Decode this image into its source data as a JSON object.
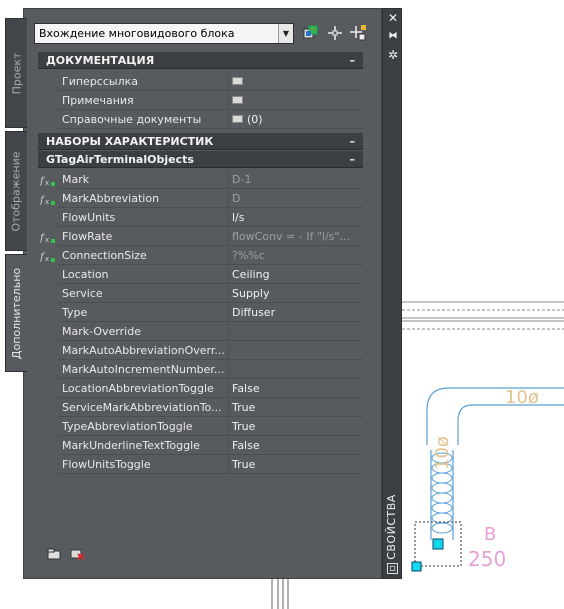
{
  "palette": {
    "selector_value": "Вхождение многовидового блока",
    "title": "СВОЙСТВА",
    "side_tabs": [
      "Проект",
      "Отображение",
      "Дополнительно"
    ]
  },
  "sections": {
    "doc": "ДОКУМЕНТАЦИЯ",
    "sets": "НАБОРЫ ХАРАКТЕРИСТИК",
    "gtag": "GTagAirTerminalObjects"
  },
  "doc_rows": [
    {
      "name": "Гиперссылка",
      "value": ""
    },
    {
      "name": "Примечания",
      "value": ""
    },
    {
      "name": "Справочные документы",
      "value": "(0)"
    }
  ],
  "rows": [
    {
      "name": "Mark",
      "value": "D-1",
      "formula": true
    },
    {
      "name": "MarkAbbreviation",
      "value": "D",
      "formula": true
    },
    {
      "name": "FlowUnits",
      "value": "l/s",
      "formula": false
    },
    {
      "name": "FlowRate",
      "value": "flowConv = - If \"l/s\"...",
      "formula": true
    },
    {
      "name": "ConnectionSize",
      "value": "?%%c",
      "formula": true
    },
    {
      "name": "Location",
      "value": "Ceiling",
      "formula": false
    },
    {
      "name": "Service",
      "value": "Supply",
      "formula": false
    },
    {
      "name": "Type",
      "value": "Diffuser",
      "formula": false
    },
    {
      "name": "Mark-Override",
      "value": "",
      "formula": false
    },
    {
      "name": "MarkAutoAbbreviationOverr...",
      "value": "",
      "formula": false
    },
    {
      "name": "MarkAutoIncrementNumber...",
      "value": "",
      "formula": false
    },
    {
      "name": "LocationAbbreviationToggle",
      "value": "False",
      "formula": false
    },
    {
      "name": "ServiceMarkAbbreviationTo...",
      "value": "True",
      "formula": false
    },
    {
      "name": "TypeAbbreviationToggle",
      "value": "True",
      "formula": false
    },
    {
      "name": "MarkUnderlineTextToggle",
      "value": "False",
      "formula": false
    },
    {
      "name": "FlowUnitsToggle",
      "value": "True",
      "formula": false
    }
  ],
  "drawing": {
    "duct_label_h": "10ø",
    "duct_label_v": "10ø",
    "tag_letter": "B",
    "tag_number": "250"
  }
}
